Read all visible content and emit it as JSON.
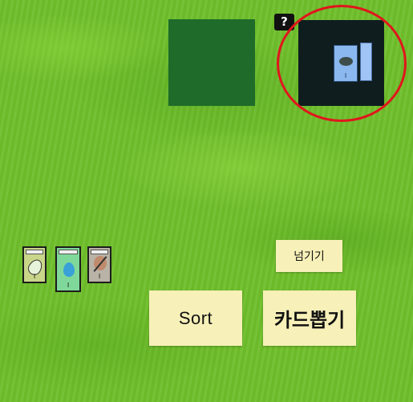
{
  "game": {
    "help_label": "?",
    "preview_card_number": "I",
    "hand": [
      {
        "name": "leaf-card",
        "number": "I"
      },
      {
        "name": "water-card",
        "number": "I"
      },
      {
        "name": "feather-card",
        "number": "I"
      }
    ],
    "buttons": {
      "pass_label": "넘기기",
      "sort_label": "Sort",
      "draw_label": "카드뽑기"
    },
    "colors": {
      "highlight": "#e0161c",
      "button_bg": "#f7f0b8",
      "deck_slot": "#1e6b2a",
      "preview_bg": "#0f1d1f"
    }
  }
}
